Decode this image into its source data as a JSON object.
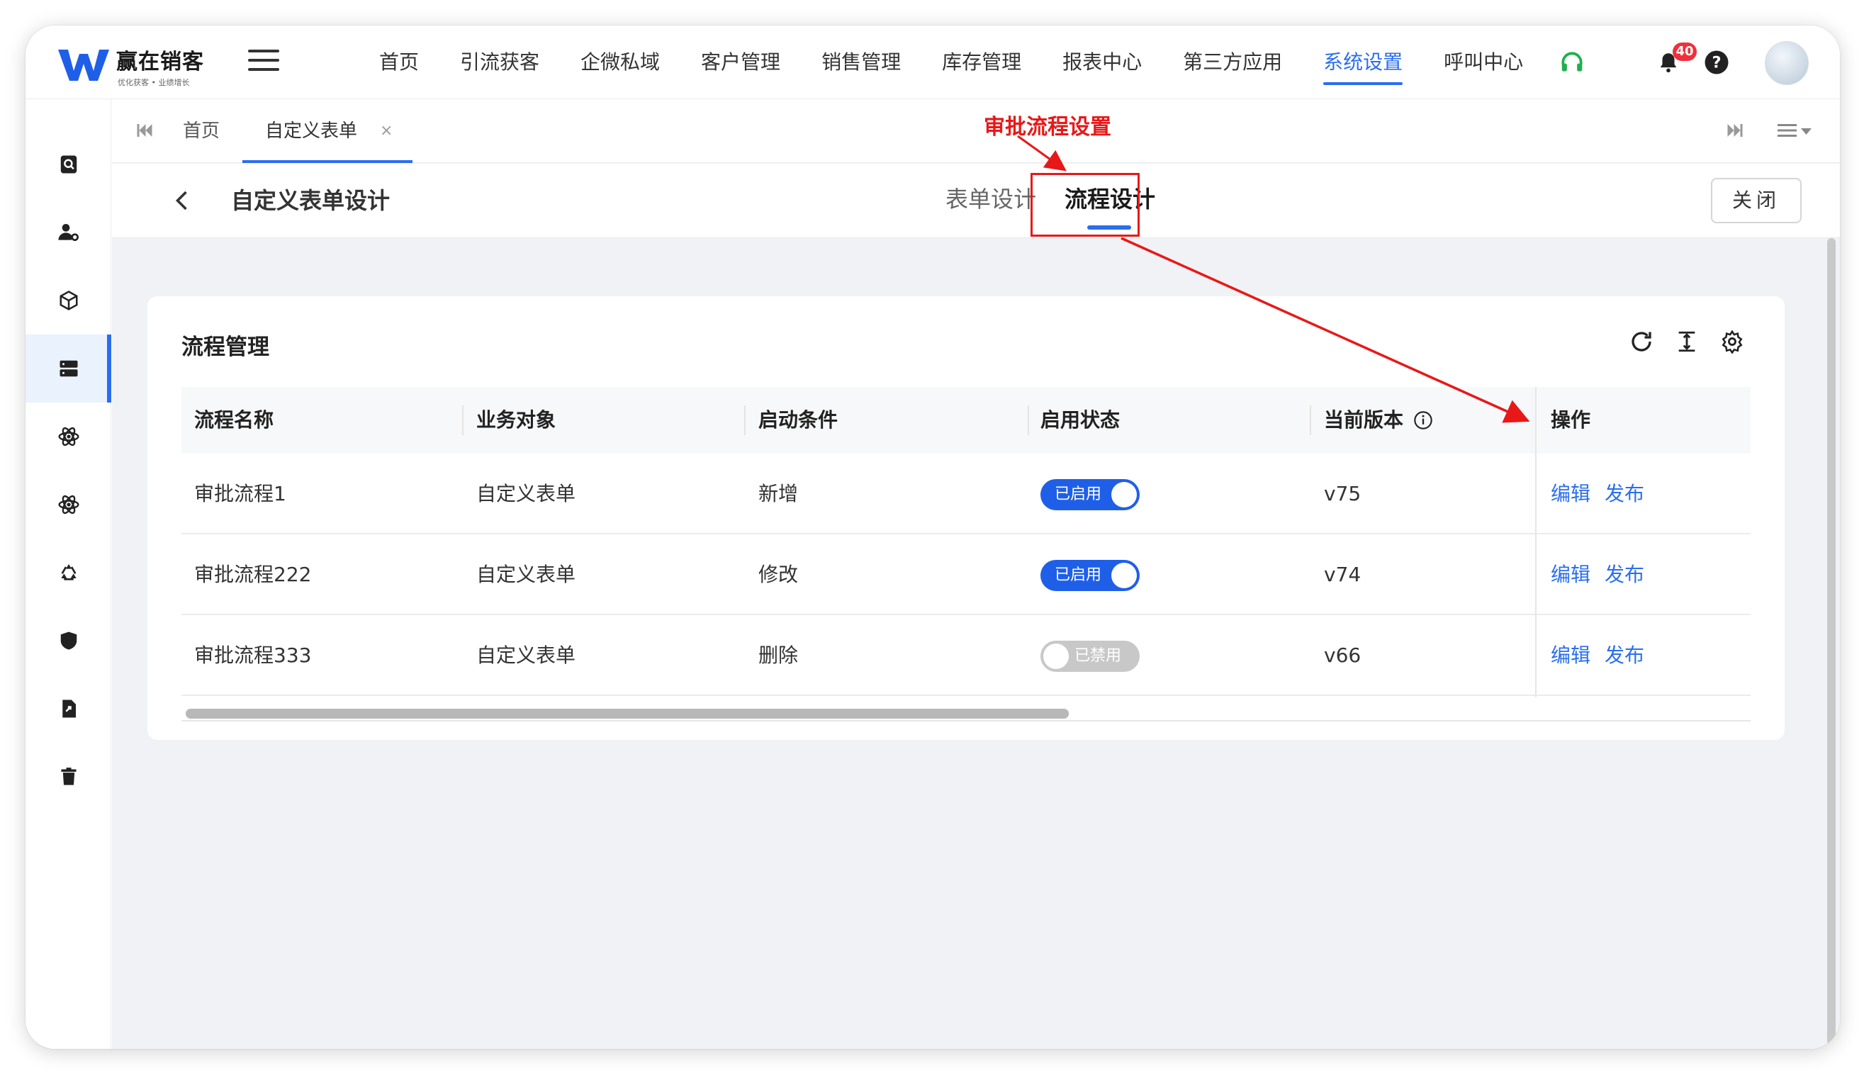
{
  "app": {
    "logo_name": "赢在销客",
    "logo_slogan": "优化获客 • 业绩增长"
  },
  "topnav": {
    "items": [
      "首页",
      "引流获客",
      "企微私域",
      "客户管理",
      "销售管理",
      "库存管理",
      "报表中心",
      "第三方应用",
      "系统设置",
      "呼叫中心"
    ],
    "active_index": 8,
    "notification_count": "40"
  },
  "sidebar": {
    "icons": [
      "search-doc-icon",
      "user-settings-icon",
      "cube-icon",
      "server-icon",
      "atom-icon",
      "atom-icon-2",
      "recycle-icon",
      "shield-icon",
      "file-export-icon",
      "trash-icon"
    ],
    "active_index": 3
  },
  "tabs": {
    "home": "首页",
    "current": "自定义表单",
    "close": "×"
  },
  "page": {
    "title": "自定义表单设计",
    "tab_form": "表单设计",
    "tab_flow": "流程设计",
    "close_button": "关闭"
  },
  "annotation": {
    "text": "审批流程设置",
    "color": "#e81818"
  },
  "card": {
    "title": "流程管理"
  },
  "table": {
    "columns": [
      "流程名称",
      "业务对象",
      "启动条件",
      "启用状态",
      "当前版本",
      "操作"
    ],
    "rows": [
      {
        "name": "审批流程1",
        "object": "自定义表单",
        "condition": "新增",
        "status": "已启用",
        "enabled": true,
        "version": "v75",
        "edit": "编辑",
        "publish": "发布"
      },
      {
        "name": "审批流程222",
        "object": "自定义表单",
        "condition": "修改",
        "status": "已启用",
        "enabled": true,
        "version": "v74",
        "edit": "编辑",
        "publish": "发布"
      },
      {
        "name": "审批流程333",
        "object": "自定义表单",
        "condition": "删除",
        "status": "已禁用",
        "enabled": false,
        "version": "v66",
        "edit": "编辑",
        "publish": "发布"
      }
    ]
  },
  "colors": {
    "accent": "#2a6ef0",
    "switch_on": "#1f5fe8",
    "switch_off": "#c8c8c8",
    "annotation": "#e81818"
  }
}
